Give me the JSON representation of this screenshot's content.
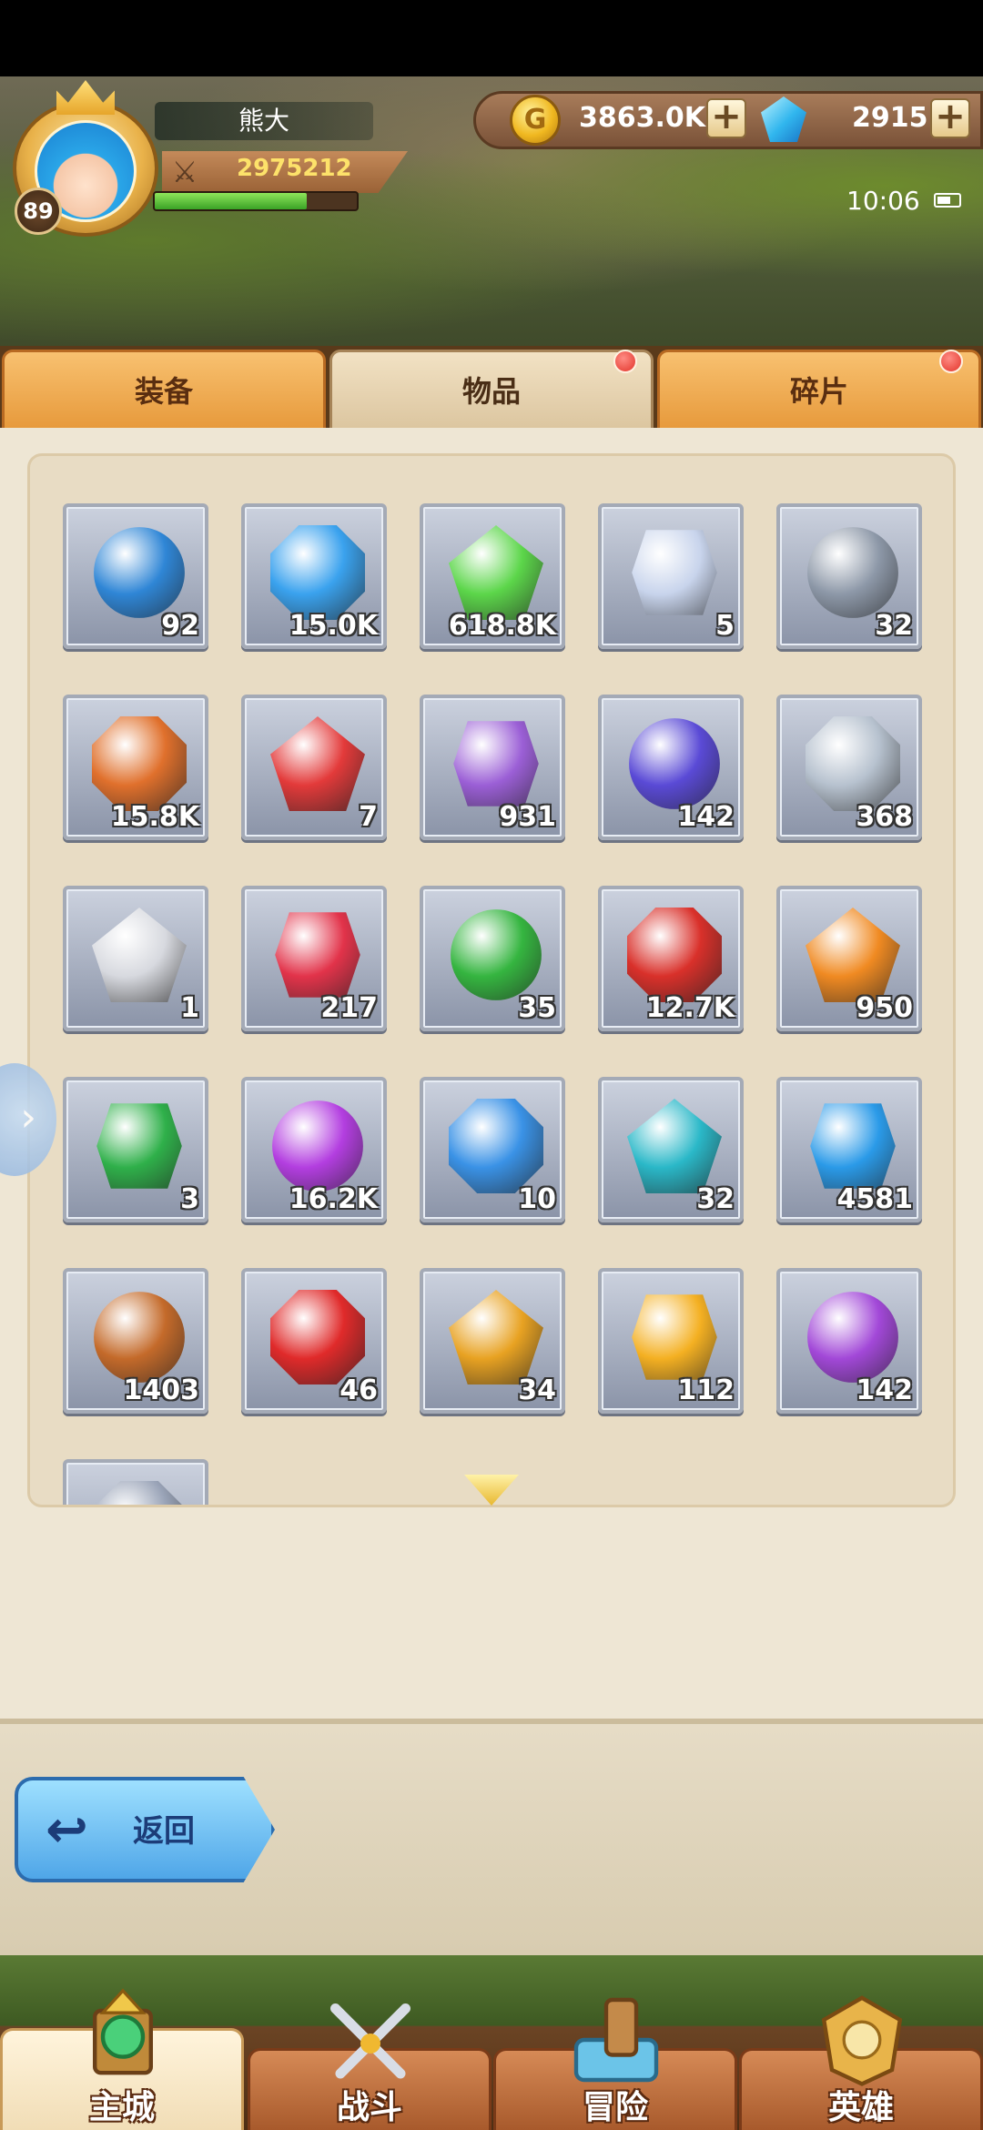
{
  "player": {
    "name": "熊大",
    "level": "89",
    "power": "2975212",
    "exp_fraction": 0.75
  },
  "currency": {
    "gold": "3863.0K",
    "gems": "2915",
    "gold_icon_glyph": "G",
    "plus_glyph": "+"
  },
  "clock": "10:06",
  "tabs": [
    {
      "label": "装备",
      "notify": false
    },
    {
      "label": "物品",
      "notify": true
    },
    {
      "label": "碎片",
      "notify": true
    }
  ],
  "items": [
    {
      "count": "92",
      "icon": "blue-egg-icon",
      "color": "#2f86d6"
    },
    {
      "count": "15.0K",
      "icon": "blue-crystal-icon",
      "color": "#3aa2ee"
    },
    {
      "count": "618.8K",
      "icon": "green-potion-icon",
      "color": "#5cd64a"
    },
    {
      "count": "5",
      "icon": "scroll-icon",
      "color": "#c8d4ec"
    },
    {
      "count": "32",
      "icon": "key-icon",
      "color": "#8d98a8"
    },
    {
      "count": "15.8K",
      "icon": "rune-stone-icon",
      "color": "#e0702c"
    },
    {
      "count": "7",
      "icon": "red-sword-gem-icon",
      "color": "#e33a3a"
    },
    {
      "count": "931",
      "icon": "purple-jar-icon",
      "color": "#9b5fd6"
    },
    {
      "count": "142",
      "icon": "purple-boots-gem-icon",
      "color": "#5a4ad6"
    },
    {
      "count": "368",
      "icon": "silver-coin-icon",
      "color": "#b7c2cf"
    },
    {
      "count": "1",
      "icon": "skull-box-icon",
      "color": "#d7d9df"
    },
    {
      "count": "217",
      "icon": "red-star-icon",
      "color": "#e2334a"
    },
    {
      "count": "35",
      "icon": "clover-icon",
      "color": "#35b540"
    },
    {
      "count": "12.7K",
      "icon": "red-potion-icon",
      "color": "#d9302a"
    },
    {
      "count": "950",
      "icon": "orange-vial-icon",
      "color": "#f08a22"
    },
    {
      "count": "3",
      "icon": "green-glove-gem-icon",
      "color": "#2fb04a"
    },
    {
      "count": "16.2K",
      "icon": "purple-potion-icon",
      "color": "#b33ee0"
    },
    {
      "count": "10",
      "icon": "blue-shield-gem-icon",
      "color": "#3a92e6"
    },
    {
      "count": "32",
      "icon": "teal-flask-icon",
      "color": "#2ab8c8"
    },
    {
      "count": "4581",
      "icon": "blue-orb-icon",
      "color": "#2a9ae8"
    },
    {
      "count": "1403",
      "icon": "bronze-coin-icon",
      "color": "#c46a2a"
    },
    {
      "count": "46",
      "icon": "heart-icon",
      "color": "#e02a2a"
    },
    {
      "count": "34",
      "icon": "lightning-stone-icon",
      "color": "#e8a222"
    },
    {
      "count": "112",
      "icon": "yellow-armor-gem-icon",
      "color": "#f4b022"
    },
    {
      "count": "142",
      "icon": "purple-helmet-gem-icon",
      "color": "#a248d8"
    },
    {
      "count": "",
      "icon": "partial-item-icon",
      "color": "#9aa4b8"
    }
  ],
  "back_button": {
    "label": "返回",
    "icon_glyph": "↩"
  },
  "bottom_nav": [
    {
      "label": "主城",
      "icon": "main-city-icon",
      "active": true
    },
    {
      "label": "战斗",
      "icon": "crossed-swords-icon",
      "active": false
    },
    {
      "label": "冒险",
      "icon": "adventure-map-icon",
      "active": false
    },
    {
      "label": "英雄",
      "icon": "hero-emblem-icon",
      "active": false
    }
  ]
}
